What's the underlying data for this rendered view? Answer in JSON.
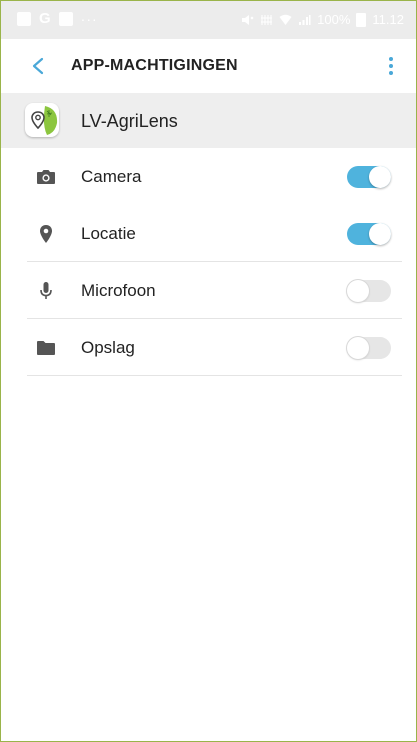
{
  "status_bar": {
    "left_icons": [
      "image-icon",
      "google-icon",
      "calendar-icon",
      "more-dots-icon"
    ],
    "right_icons": [
      "mute-icon",
      "nfc-icon",
      "wifi-icon",
      "signal-icon",
      "battery-charging-icon"
    ],
    "google_glyph": "G",
    "dots": "···",
    "battery": "100%",
    "time": "11.12"
  },
  "toolbar": {
    "title": "APP-MACHTIGINGEN",
    "back_icon": "chevron-left-icon",
    "more_icon": "more-vertical-icon"
  },
  "app": {
    "name": "LV-AgriLens",
    "icon": "location-pin-leaf-icon"
  },
  "permissions": [
    {
      "label": "Camera",
      "icon": "camera-icon",
      "enabled": true
    },
    {
      "label": "Locatie",
      "icon": "location-icon",
      "enabled": true
    },
    {
      "label": "Microfoon",
      "icon": "microphone-icon",
      "enabled": false
    },
    {
      "label": "Opslag",
      "icon": "folder-icon",
      "enabled": false
    }
  ],
  "colors": {
    "accent": "#4fb3dd",
    "toggle_off": "#e6e6e6",
    "frame_border": "#9ab44a",
    "app_row_bg": "#eeeeee",
    "icon_gray": "#555555"
  }
}
